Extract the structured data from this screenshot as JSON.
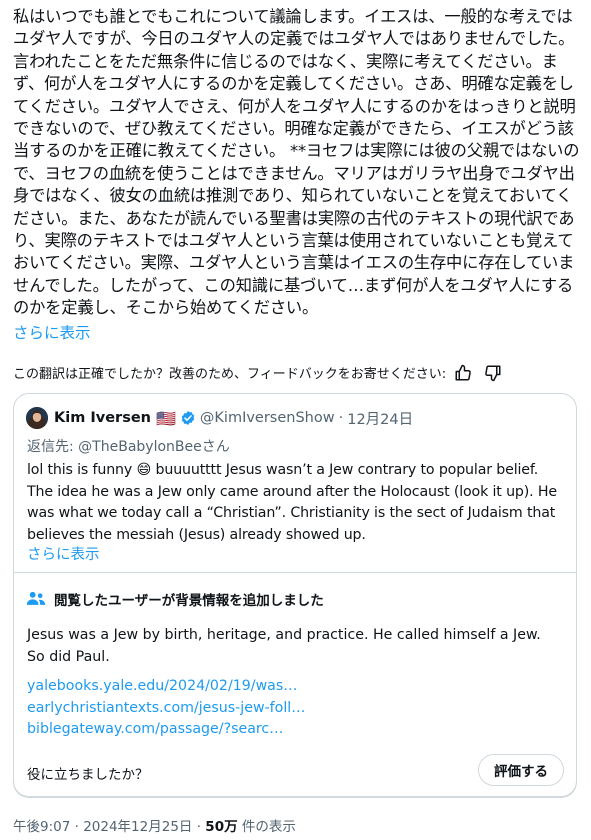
{
  "post": {
    "text": "私はいつでも誰とでもこれについて議論します。イエスは、一般的な考えではユダヤ人ですが、今日のユダヤ人の定義ではユダヤ人ではありませんでした。言われたことをただ無条件に信じるのではなく、実際に考えてください。まず、何が人をユダヤ人にするのかを定義してください。さあ、明確な定義をしてください。ユダヤ人でさえ、何が人をユダヤ人にするのかをはっきりと説明できないので、ぜひ教えてください。明確な定義ができたら、イエスがどう該当するのかを正確に教えてください。 **ヨセフは実際には彼の父親ではないので、ヨセフの血統を使うことはできません。マリアはガリラヤ出身でユダヤ出身ではなく、彼女の血統は推測であり、知られていないことを覚えておいてください。また、あなたが読んでいる聖書は実際の古代のテキストの現代訳であり、実際のテキストではユダヤ人という言葉は使用されていないことも覚えておいてください。実際、ユダヤ人という言葉はイエスの生存中に存在していませんでした。したがって、この知識に基づいて…まず何が人をユダヤ人にするのかを定義し、そこから始めてください。",
    "show_more": "さらに表示"
  },
  "translation_feedback": {
    "text": "この翻訳は正確でしたか？改善のため、フィードバックをお寄せください:",
    "icons": [
      "thumbs-up-icon",
      "thumbs-down-icon"
    ]
  },
  "quote": {
    "author_name": "Kim Iversen",
    "flag": "🇺🇸",
    "handle": "@KimIversenShow",
    "date": "12月24日",
    "reply_prefix": "返信先: ",
    "reply_handle": "@TheBabylonBee",
    "reply_suffix": "さん",
    "text": "lol this is funny 😄 buuuutttt Jesus wasn’t a Jew contrary to popular belief. The idea he was a Jew only came around after the Holocaust (look it up). He was what we today call a “Christian”. Christianity is the sect of Judaism that believes the messiah (Jesus) already showed up.",
    "show_more": "さらに表示",
    "community_note": {
      "header": "閲覧したユーザーが背景情報を追加しました",
      "text": "Jesus was a Jew by birth, heritage, and practice. He called himself a Jew. So did Paul.",
      "links": [
        "yalebooks.yale.edu/2024/02/19/was…",
        "earlychristiantexts.com/jesus-jew-foll…",
        "biblegateway.com/passage/?searc…"
      ],
      "question": "役に立ちましたか？",
      "rate_button": "評価する"
    }
  },
  "footer": {
    "time": "午後9:07",
    "separator": " · ",
    "date": "2024年12月25日",
    "views_count": "50万",
    "views_label": " 件の表示"
  },
  "colors": {
    "link": "#1d9bf0",
    "text": "#0f1419",
    "secondary": "#536471",
    "border": "#cfd9de",
    "verified": "#1d9bf0"
  }
}
